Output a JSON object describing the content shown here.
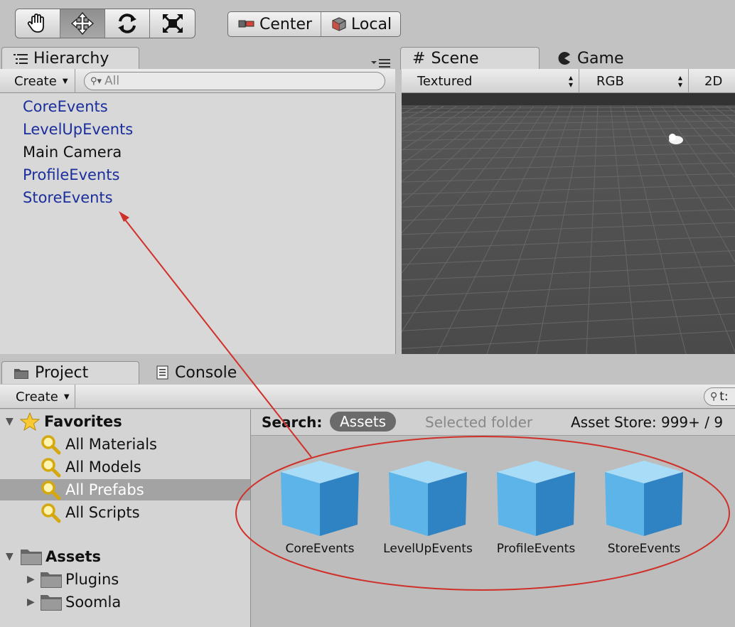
{
  "toolbar": {
    "tools": [
      {
        "icon": "hand-icon"
      },
      {
        "icon": "move-arrows-icon"
      },
      {
        "icon": "rotate-icon"
      },
      {
        "icon": "scale-icon"
      }
    ],
    "pivot": {
      "label": "Center",
      "icon": "pivot-center-icon"
    },
    "space": {
      "label": "Local",
      "icon": "local-cube-icon"
    }
  },
  "hierarchy": {
    "tab_label": "Hierarchy",
    "create_label": "Create",
    "search_placeholder": "All",
    "items": [
      {
        "label": "CoreEvents",
        "prefab": true
      },
      {
        "label": "LevelUpEvents",
        "prefab": true
      },
      {
        "label": "Main Camera",
        "prefab": false
      },
      {
        "label": "ProfileEvents",
        "prefab": true
      },
      {
        "label": "StoreEvents",
        "prefab": true
      }
    ]
  },
  "scene": {
    "tabs": [
      {
        "label": "Scene"
      },
      {
        "label": "Game"
      }
    ],
    "render_mode": "Textured",
    "color_mode": "RGB",
    "mode_2d": "2D"
  },
  "project": {
    "tabs": [
      {
        "label": "Project"
      },
      {
        "label": "Console"
      }
    ],
    "create_label": "Create",
    "search_text": "t:",
    "favorites_label": "Favorites",
    "favorites": [
      {
        "label": "All Materials"
      },
      {
        "label": "All Models"
      },
      {
        "label": "All Prefabs",
        "selected": true
      },
      {
        "label": "All Scripts"
      }
    ],
    "assets_label": "Assets",
    "folders": [
      {
        "label": "Plugins"
      },
      {
        "label": "Soomla"
      }
    ],
    "search_bar": {
      "label": "Search:",
      "scope_assets": "Assets",
      "scope_folder": "Selected folder",
      "asset_store": "Asset Store: 999+ / 9"
    },
    "assets": [
      {
        "label": "CoreEvents"
      },
      {
        "label": "LevelUpEvents"
      },
      {
        "label": "ProfileEvents"
      },
      {
        "label": "StoreEvents"
      }
    ]
  },
  "colors": {
    "prefab_text": "#1b2e9c",
    "annotation": "#d0302a",
    "selection": "#a3a3a3",
    "cube": "#4fa6e0"
  }
}
